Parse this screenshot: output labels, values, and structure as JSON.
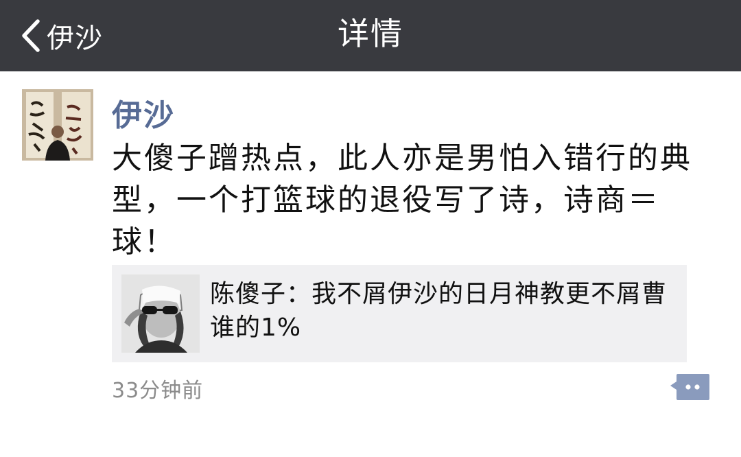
{
  "navbar": {
    "back_label": "伊沙",
    "title": "详情"
  },
  "moment": {
    "username": "伊沙",
    "text": "大傻子蹭热点，此人亦是男怕入错行的典型，一个打篮球的退役写了诗，诗商＝球！",
    "shared": {
      "text": "陈傻子：我不屑伊沙的日月神教更不屑曹谁的1%"
    },
    "time": "33分钟前"
  },
  "colors": {
    "navbar_bg": "#393a3f",
    "username": "#576b95",
    "card_bg": "#f0f0f2",
    "time": "#8b8b8b",
    "comment_icon": "#8a9bbd"
  },
  "icons": {
    "back": "chevron-left-icon",
    "comment": "comment-bubble-icon"
  }
}
